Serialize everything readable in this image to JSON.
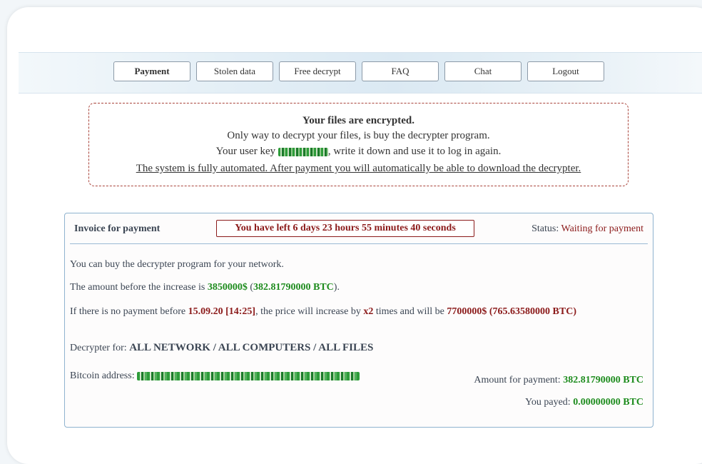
{
  "nav": {
    "payment": "Payment",
    "stolen_data": "Stolen data",
    "free_decrypt": "Free decrypt",
    "faq": "FAQ",
    "chat": "Chat",
    "logout": "Logout"
  },
  "notice": {
    "title": "Your files are encrypted.",
    "line2": "Only way to decrypt your files, is buy the decrypter program.",
    "line3_prefix": "Your user key ",
    "line3_suffix": ", write it down and use it to log in again.",
    "line4": "The system is fully automated. After payment you will automatically be able to download the decrypter."
  },
  "invoice": {
    "heading": "Invoice for payment",
    "timer": "You have left 6 days 23 hours 55 minutes 40 seconds",
    "status_label": "Status: ",
    "status_value": "Waiting for payment",
    "line1": "You can buy the decrypter program for your network.",
    "line2_prefix": "The amount before the increase is ",
    "amount_usd": "3850000$",
    "paren_open": " (",
    "amount_btc": "382.81790000 BTC",
    "paren_close": ").",
    "line3_prefix": "If there is no payment before ",
    "deadline": "15.09.20 [14:25]",
    "line3_mid": ", the price will increase by ",
    "multiplier": "x2",
    "line3_mid2": " times and will be ",
    "increased_usd": "7700000$",
    "increased_btc": " (765.63580000 BTC)",
    "decrypter_for_label": "Decrypter for: ",
    "decrypter_for_value": "ALL NETWORK / ALL COMPUTERS / ALL FILES",
    "bitcoin_label": "Bitcoin address: ",
    "amount_for_payment_label": "Amount for payment: ",
    "amount_for_payment_value": "382.81790000 BTC",
    "paid_label": "You payed: ",
    "paid_value": "0.00000000 BTC"
  }
}
